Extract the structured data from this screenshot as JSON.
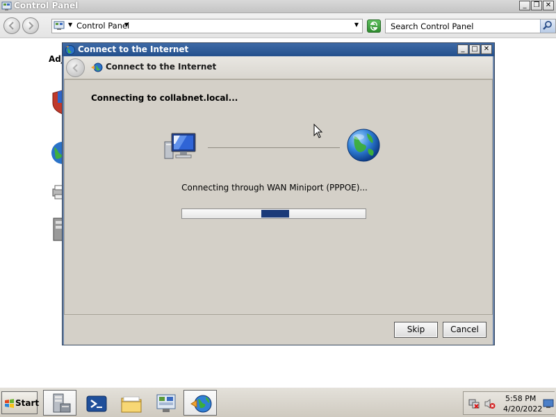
{
  "control_panel": {
    "title": "Control Panel",
    "address": "Control Panel",
    "search_placeholder": "Search Control Panel",
    "peek_label": "Adj"
  },
  "dialog": {
    "title": "Connect to the Internet",
    "nav_title": "Connect to the Internet",
    "status_heading": "Connecting to collabnet.local...",
    "through_text": "Connecting through WAN Miniport (PPPOE)...",
    "progress": {
      "start": 0.43,
      "end": 0.58,
      "indeterminate": true
    },
    "skip_label": "Skip",
    "cancel_label": "Cancel"
  },
  "taskbar": {
    "start_label": "Start",
    "buttons": [
      "server-manager-icon",
      "powershell-icon",
      "explorer-folder-icon",
      "control-panel-icon",
      "network-connect-icon"
    ],
    "active_button": "network-connect-icon",
    "clock_time": "5:58 PM",
    "clock_date": "4/20/2022"
  },
  "colors": {
    "dialog_titlebar": "#2b5797",
    "dialog_body": "#d4d0c8",
    "progress_fill": "#1b3a79"
  }
}
